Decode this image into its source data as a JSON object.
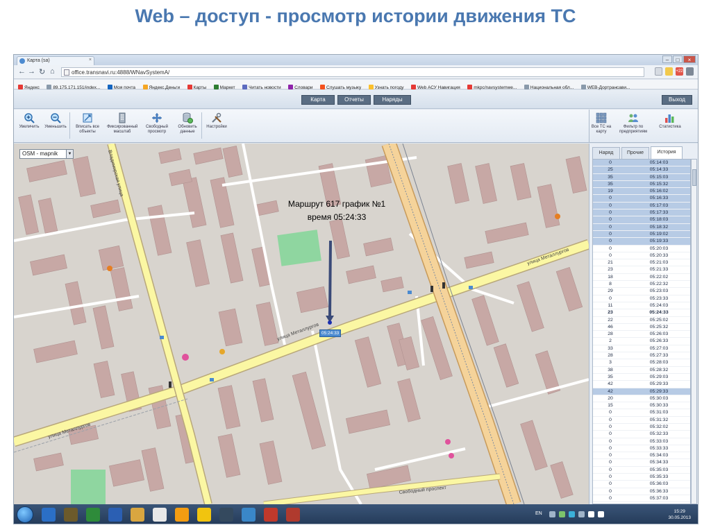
{
  "slide_title": "Web – доступ - просмотр истории движения ТС",
  "browser": {
    "tab_title": "Карта (sa)",
    "url": "office.transnavi.ru:4888/WNavSystemA/",
    "bookmarks": [
      "Яндекс",
      "89.175.171.151/index...",
      "Моя почта",
      "Яндекс.Деньги",
      "Карты",
      "Маркет",
      "Читать новости",
      "Словари",
      "Слушать музыку",
      "Узнать погоду",
      "Web АСУ Навигация",
      "mkpc/navsystemwe...",
      "Национальная обл...",
      "WEB-Дортрансави..."
    ],
    "badge": "+22"
  },
  "app": {
    "menu": [
      "Карта",
      "Отчеты",
      "Наряды"
    ],
    "exit": "Выход",
    "tools": [
      "Увеличить",
      "Уменьшить",
      "Вписать все объекты",
      "Фиксированный масштаб",
      "Свободный просмотр",
      "Обновить данные",
      "Настройки"
    ],
    "right_tools": [
      "Все ТС на карту",
      "Фильтр по предприятиям",
      "Статистика"
    ]
  },
  "map": {
    "layer": "OSM - mapnik",
    "popup_line1": "Маршрут 617 график №1",
    "popup_line2": "время 05:24:33",
    "marker_label": "05:24:33",
    "street_labels": [
      "улица Металлургов",
      "улица Металлургов",
      "улица Металлургов",
      "Владимирская улица",
      "Свободный проспект"
    ]
  },
  "panel": {
    "tabs": [
      "Наряд",
      "Прочие",
      "История"
    ],
    "active_tab": "История",
    "rows": [
      {
        "speed": "0",
        "time": "05:14:03",
        "state": "sel"
      },
      {
        "speed": "25",
        "time": "05:14:33",
        "state": "sel"
      },
      {
        "speed": "35",
        "time": "05:15:03",
        "state": "sel"
      },
      {
        "speed": "35",
        "time": "05:15:32",
        "state": "sel"
      },
      {
        "speed": "19",
        "time": "05:16:02",
        "state": "sel"
      },
      {
        "speed": "0",
        "time": "05:16:33",
        "state": "sel"
      },
      {
        "speed": "0",
        "time": "05:17:03",
        "state": "sel"
      },
      {
        "speed": "0",
        "time": "05:17:33",
        "state": "sel"
      },
      {
        "speed": "0",
        "time": "05:18:03",
        "state": "sel"
      },
      {
        "speed": "0",
        "time": "05:18:32",
        "state": "sel"
      },
      {
        "speed": "0",
        "time": "05:19:02",
        "state": "sel"
      },
      {
        "speed": "0",
        "time": "05:19:33",
        "state": "sel"
      },
      {
        "speed": "0",
        "time": "05:20:03",
        "state": ""
      },
      {
        "speed": "0",
        "time": "05:20:33",
        "state": ""
      },
      {
        "speed": "21",
        "time": "05:21:03",
        "state": ""
      },
      {
        "speed": "23",
        "time": "05:21:33",
        "state": ""
      },
      {
        "speed": "18",
        "time": "05:22:02",
        "state": ""
      },
      {
        "speed": "8",
        "time": "05:22:32",
        "state": ""
      },
      {
        "speed": "29",
        "time": "05:23:03",
        "state": ""
      },
      {
        "speed": "0",
        "time": "05:23:33",
        "state": ""
      },
      {
        "speed": "11",
        "time": "05:24:03",
        "state": ""
      },
      {
        "speed": "23",
        "time": "05:24:33",
        "state": "cur"
      },
      {
        "speed": "22",
        "time": "05:25:02",
        "state": ""
      },
      {
        "speed": "46",
        "time": "05:25:32",
        "state": ""
      },
      {
        "speed": "28",
        "time": "05:26:03",
        "state": ""
      },
      {
        "speed": "2",
        "time": "05:26:33",
        "state": ""
      },
      {
        "speed": "33",
        "time": "05:27:03",
        "state": ""
      },
      {
        "speed": "28",
        "time": "05:27:33",
        "state": ""
      },
      {
        "speed": "3",
        "time": "05:28:03",
        "state": ""
      },
      {
        "speed": "38",
        "time": "05:28:32",
        "state": ""
      },
      {
        "speed": "35",
        "time": "05:29:03",
        "state": ""
      },
      {
        "speed": "42",
        "time": "05:29:33",
        "state": ""
      },
      {
        "speed": "42",
        "time": "05:29:33",
        "state": "sel"
      },
      {
        "speed": "20",
        "time": "05:30:03",
        "state": ""
      },
      {
        "speed": "15",
        "time": "05:30:33",
        "state": ""
      },
      {
        "speed": "0",
        "time": "05:31:03",
        "state": ""
      },
      {
        "speed": "0",
        "time": "05:31:32",
        "state": ""
      },
      {
        "speed": "0",
        "time": "05:32:02",
        "state": ""
      },
      {
        "speed": "0",
        "time": "05:32:33",
        "state": ""
      },
      {
        "speed": "0",
        "time": "05:33:03",
        "state": ""
      },
      {
        "speed": "0",
        "time": "05:33:33",
        "state": ""
      },
      {
        "speed": "0",
        "time": "05:34:03",
        "state": ""
      },
      {
        "speed": "0",
        "time": "05:34:33",
        "state": ""
      },
      {
        "speed": "0",
        "time": "05:35:03",
        "state": ""
      },
      {
        "speed": "0",
        "time": "05:35:33",
        "state": ""
      },
      {
        "speed": "0",
        "time": "05:36:03",
        "state": ""
      },
      {
        "speed": "0",
        "time": "05:36:33",
        "state": ""
      },
      {
        "speed": "0",
        "time": "05:37:03",
        "state": ""
      }
    ]
  },
  "taskbar": {
    "lang": "EN",
    "time": "15:29",
    "date": "30.05.2013"
  },
  "colors": {
    "title": "#4a78b0",
    "road_major": "#f5d39a",
    "road_minor": "#fbf7a3",
    "building": "#c7a8a5",
    "park": "#8fd6a0",
    "selection": "#b7cbe5"
  }
}
